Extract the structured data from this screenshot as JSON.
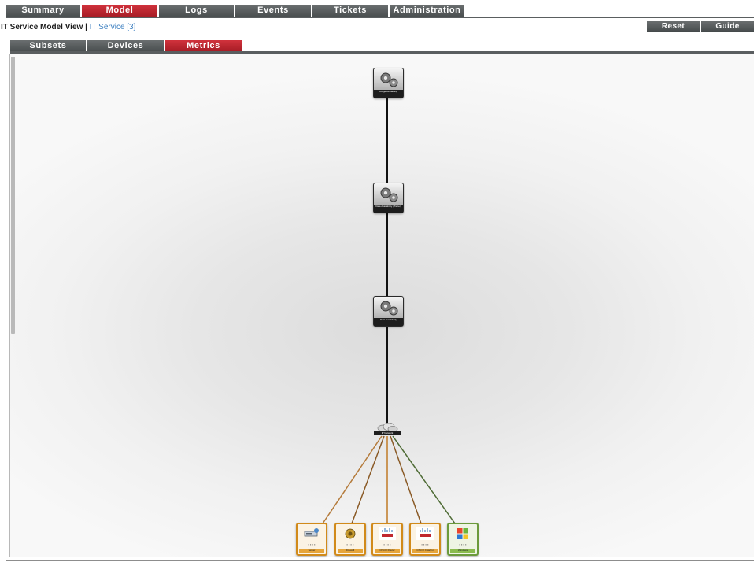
{
  "topnav": {
    "tabs": [
      {
        "label": "Summary",
        "active": false
      },
      {
        "label": "Model",
        "active": true
      },
      {
        "label": "Logs",
        "active": false
      },
      {
        "label": "Events",
        "active": false
      },
      {
        "label": "Tickets",
        "active": false
      },
      {
        "label": "Administration",
        "active": false
      }
    ]
  },
  "header": {
    "title": "IT Service Model View |",
    "link": "IT Service [3]",
    "reset_label": "Reset",
    "guide_label": "Guide"
  },
  "subtabs": [
    {
      "label": "Subsets",
      "active": false
    },
    {
      "label": "Devices",
      "active": false
    },
    {
      "label": "Metrics",
      "active": true
    }
  ],
  "diagram": {
    "services": [
      {
        "label": "Image Availability"
      },
      {
        "label": "Data Availability (Tracer)"
      },
      {
        "label": "Data Availability"
      }
    ],
    "network_label": "IP Network",
    "devices": [
      {
        "label": "Server",
        "icon": "server-icon"
      },
      {
        "label": "Firewall",
        "icon": "firewall-icon"
      },
      {
        "label": "CISCO Router",
        "icon": "cisco-router-icon"
      },
      {
        "label": "CISCO Catalyst",
        "icon": "cisco-catalyst-icon"
      },
      {
        "label": "Windows",
        "icon": "windows-icon"
      }
    ],
    "colors": {
      "line": "#111111",
      "link_orange": "#b47a3a",
      "link_green": "#4e6b35",
      "accent_red": "#c0272f"
    }
  }
}
